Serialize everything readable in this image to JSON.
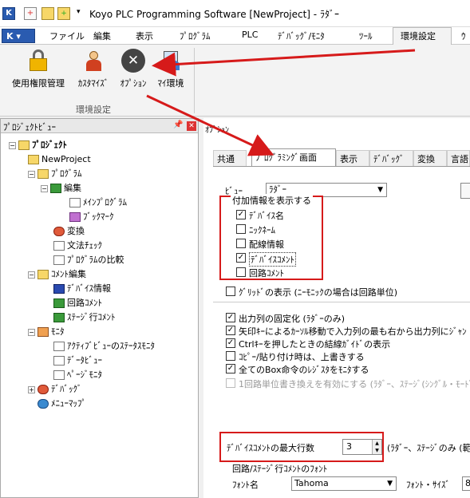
{
  "window": {
    "title": "Koyo PLC Programming Software [NewProject] - ﾗﾀﾞｰ"
  },
  "menu": {
    "app_button": "K",
    "tabs": [
      "ファイル",
      "編集",
      "表示",
      "ﾌﾟﾛｸﾞﾗﾑ",
      "PLC",
      "ﾃﾞﾊﾞｯｸﾞ/ﾓﾆﾀ",
      "ﾂｰﾙ",
      "環境設定",
      "ｳ"
    ]
  },
  "ribbon": {
    "buttons": [
      "使用権限管理",
      "ｶｽﾀﾏｲｽﾞ",
      "ｵﾌﾟｼｮﾝ",
      "ﾏｲ環境"
    ],
    "group_label": "環境設定"
  },
  "project_view": {
    "title": "ﾌﾟﾛｼﾞｪｸﾄﾋﾞｭｰ",
    "items": [
      {
        "label": "ﾌﾟﾛｼﾞｪｸﾄ"
      },
      {
        "label": "NewProject"
      },
      {
        "label": "ﾌﾟﾛｸﾞﾗﾑ"
      },
      {
        "label": "編集"
      },
      {
        "label": "ﾒｲﾝﾌﾟﾛｸﾞﾗﾑ"
      },
      {
        "label": "ﾌﾞｯｸﾏｰｸ"
      },
      {
        "label": "変換"
      },
      {
        "label": "文法ﾁｪｯｸ"
      },
      {
        "label": "ﾌﾟﾛｸﾞﾗﾑの比較"
      },
      {
        "label": "ｺﾒﾝﾄ編集"
      },
      {
        "label": "ﾃﾞﾊﾞｲｽ情報"
      },
      {
        "label": "回路ｺﾒﾝﾄ"
      },
      {
        "label": "ｽﾃｰｼﾞ行ｺﾒﾝﾄ"
      },
      {
        "label": "ﾓﾆﾀ"
      },
      {
        "label": "ｱｸﾃｨﾌﾞﾋﾞｭｰのｽﾃｰﾀｽﾓﾆﾀ"
      },
      {
        "label": "ﾃﾞｰﾀﾋﾞｭｰ"
      },
      {
        "label": "ﾍﾟｰｼﾞﾓﾆﾀ"
      },
      {
        "label": "ﾃﾞﾊﾞｯｸﾞ"
      },
      {
        "label": "ﾒﾆｭｰﾏｯﾌﾟ"
      }
    ]
  },
  "options": {
    "dialog_label": "ｵﾌﾟｼｮﾝ",
    "tabs": [
      "共通",
      "ﾌﾟﾛｸﾞﾗﾐﾝｸﾞ画面",
      "表示",
      "ﾃﾞﾊﾞｯｸﾞ",
      "変換",
      "言語"
    ],
    "view_label": "ﾋﾞｭｰ",
    "view_value": "ﾗﾀﾞｰ",
    "addinfo_title": "付加情報を表示する",
    "addinfo": [
      {
        "label": "ﾃﾞﾊﾞｲｽ名",
        "checked": "✓"
      },
      {
        "label": "ﾆｯｸﾈｰﾑ",
        "checked": ""
      },
      {
        "label": "配線情報",
        "checked": ""
      },
      {
        "label": "ﾃﾞﾊﾞｲｽｺﾒﾝﾄ",
        "checked": "✓"
      },
      {
        "label": "回路ｺﾒﾝﾄ",
        "checked": ""
      }
    ],
    "grid_label": "ｸﾞﾘｯﾄﾞの表示 (ﾆｰﾓﾆｯｸの場合は回路単位)",
    "settings": [
      {
        "label": "出力列の固定化 (ﾗﾀﾞｰのみ)",
        "checked": "✓"
      },
      {
        "label": "矢印ｷｰによるｶｰｿﾙ移動で入力列の最も右から出力列にｼﾞｬﾝ",
        "checked": "✓"
      },
      {
        "label": "Ctrlｷｰを押したときの結線ｶﾞｲﾄﾞの表示",
        "checked": "✓"
      },
      {
        "label": "ｺﾋﾟｰ/貼り付け時は、上書きする",
        "checked": ""
      },
      {
        "label": "全てのBox命令のﾚｼﾞｽﾀをﾓﾆﾀする",
        "checked": "✓"
      },
      {
        "label": "1回路単位書き換えを有効にする (ﾗﾀﾞｰ、ｽﾃｰｼﾞ(ｼﾝｸﾞﾙ・ﾓｰﾄﾞ",
        "checked": ""
      }
    ],
    "max_lines_label": "ﾃﾞﾊﾞｲｽｺﾒﾝﾄの最大行数",
    "max_lines_value": "3",
    "max_lines_note": "(ﾗﾀﾞｰ、ｽﾃｰｼﾞのみ (範",
    "font_section": "回路/ｽﾃｰｼﾞ行ｺﾒﾝﾄのﾌｫﾝﾄ",
    "font_name_label": "ﾌｫﾝﾄ名",
    "font_name_value": "Tahoma",
    "font_size_label": "ﾌｫﾝﾄ・ｻｲｽﾞ",
    "font_size_value": "8"
  }
}
